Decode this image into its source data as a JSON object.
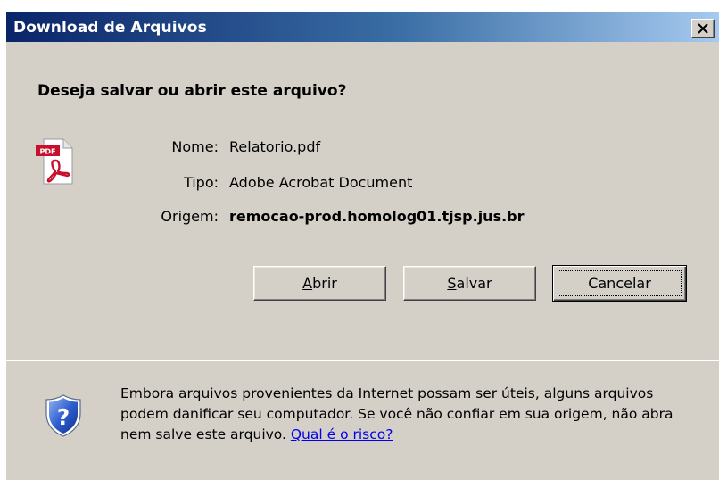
{
  "window": {
    "title": "Download de Arquivos",
    "close_label": "×"
  },
  "dialog": {
    "question": "Deseja salvar ou abrir este arquivo?",
    "file_icon": "pdf-file-icon",
    "name_label": "Nome:",
    "name_value": "Relatorio.pdf",
    "type_label": "Tipo:",
    "type_value": "Adobe Acrobat Document",
    "origin_label": "Origem:",
    "origin_value": "remocao-prod.homolog01.tjsp.jus.br"
  },
  "buttons": {
    "open": {
      "mnemonic": "A",
      "rest": "brir"
    },
    "save": {
      "mnemonic": "S",
      "rest": "alvar"
    },
    "cancel": {
      "label": "Cancelar"
    }
  },
  "warning": {
    "icon": "shield-question-icon",
    "text": "Embora arquivos provenientes da Internet possam ser úteis, alguns arquivos podem danificar seu computador. Se você não confiar em sua origem, não abra nem salve este arquivo. ",
    "link": "Qual é o risco?"
  },
  "colors": {
    "titlebar_start": "#0a246a",
    "titlebar_end": "#a6caf0",
    "dialog_face": "#d4d0c8",
    "link": "#0000ee"
  }
}
